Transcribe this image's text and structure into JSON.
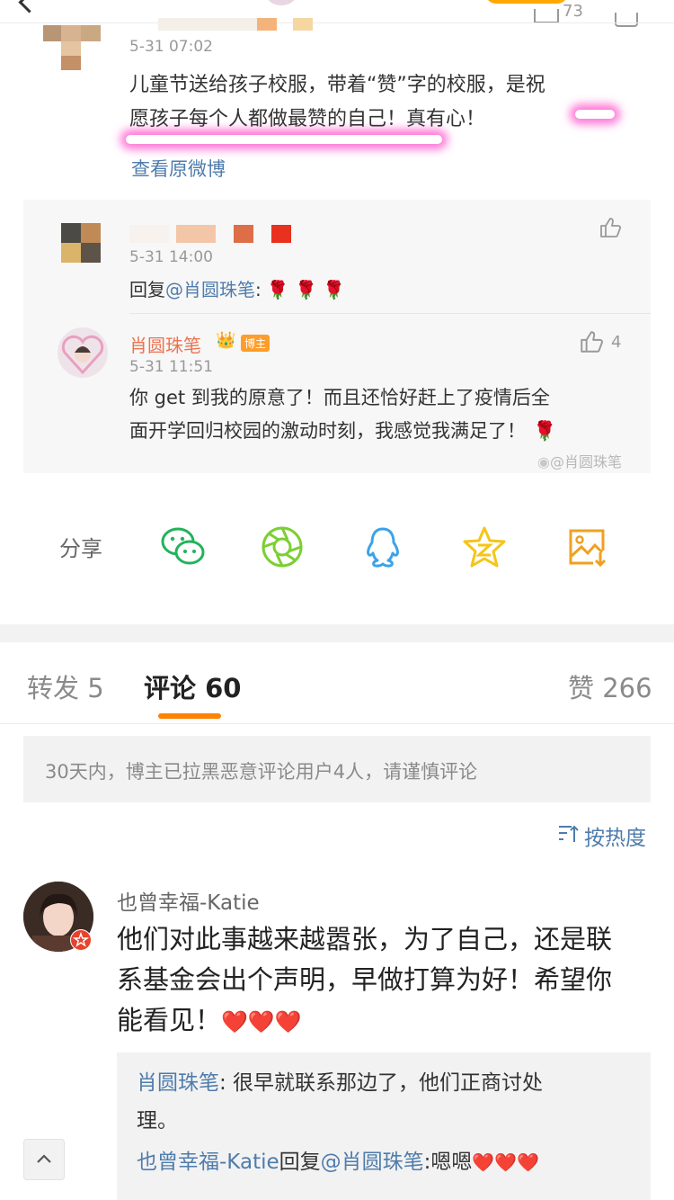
{
  "post": {
    "time": "5-31 07:02",
    "text_line1": "儿童节送给孩子校服，带着“赞”字的校服，是祝",
    "text_line2": "愿孩子每个人都做最赞的自己！真有心！",
    "view_original": "查看原微博",
    "top_like_count": "73"
  },
  "quote": {
    "reply1": {
      "time": "5-31 14:00",
      "prefix": "回复",
      "mention": "@肖圆珠笔",
      "suffix": ":",
      "roses": "🌹 🌹 🌹"
    },
    "reply2": {
      "name": "肖圆珠笔",
      "crown": "👑",
      "badge": "博主",
      "time": "5-31 11:51",
      "like_count": "4",
      "text_line1": "你 get 到我的原意了！而且还恰好赶上了疫情后全",
      "text_line2": "面开学回归校园的激动时刻，我感觉我满足了！",
      "rose": "🌹"
    },
    "watermark": "@肖圆珠笔"
  },
  "share": {
    "label": "分享",
    "icons": [
      "wechat-icon",
      "moments-icon",
      "qq-icon",
      "qzone-icon",
      "save-image-icon"
    ],
    "colors": {
      "wechat": "#22b35a",
      "moments": "#7ccf32",
      "qq": "#3aa3e8",
      "qzone": "#f5c518",
      "save": "#f0a020"
    }
  },
  "tabs": {
    "repost": "转发 5",
    "comment": "评论 60",
    "like": "赞 266"
  },
  "notice": "30天内，博主已拉黑恶意评论用户4人，请谨慎评论",
  "sort": {
    "label": "按热度"
  },
  "comment": {
    "name": "也曾幸福-Katie",
    "line1": "他们对此事越来越嚣张，为了自己，还是联",
    "line2": "系基金会出个声明，早做打算为好！希望你",
    "line3": "能看见！",
    "hearts": "❤️❤️❤️",
    "replies": [
      {
        "author": "肖圆珠笔",
        "text": ": 很早就联系那边了，他们正商讨处",
        "text2": "理。"
      },
      {
        "author": "也曾幸福-Katie",
        "action": "回复",
        "mention": "@肖圆珠笔",
        "text": ":嗯嗯",
        "hearts": "❤️❤️❤️"
      }
    ]
  },
  "accent_colors": {
    "link": "#4f7cac",
    "tab_underline": "#ff8200",
    "badge": "#e8412c"
  }
}
